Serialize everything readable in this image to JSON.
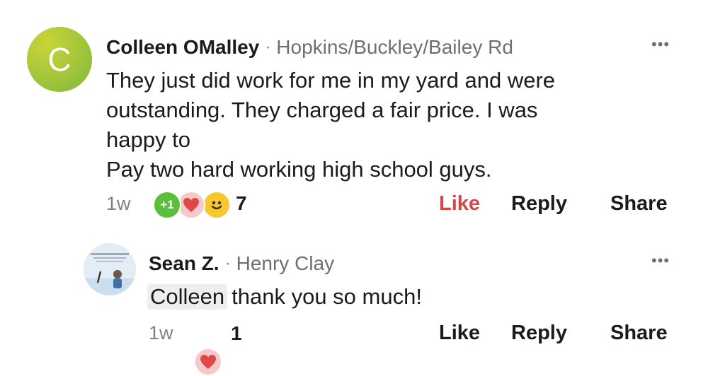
{
  "comment1": {
    "avatar_letter": "C",
    "author": "Colleen OMalley",
    "separator": "·",
    "neighborhood": "Hopkins/Buckley/Bailey Rd",
    "more": "•••",
    "text_lines": [
      "They just did work for me in my yard and were",
      "outstanding. They charged a fair price. I was",
      "happy to",
      "Pay two hard working high school guys."
    ],
    "time": "1w",
    "reactions": [
      "plus-one-icon",
      "heart-icon",
      "smile-icon"
    ],
    "reaction_plus_label": "+1",
    "reaction_count": "7",
    "like_label": "Like",
    "reply_label": "Reply",
    "share_label": "Share",
    "like_color": "#d54646"
  },
  "comment2": {
    "author": "Sean Z.",
    "separator": "·",
    "neighborhood": "Henry Clay",
    "more": "•••",
    "mention": "Colleen",
    "text": "thank you so much!",
    "time": "1w",
    "reactions": [
      "heart-icon"
    ],
    "reaction_count": "1",
    "like_label": "Like",
    "reply_label": "Reply",
    "share_label": "Share"
  }
}
